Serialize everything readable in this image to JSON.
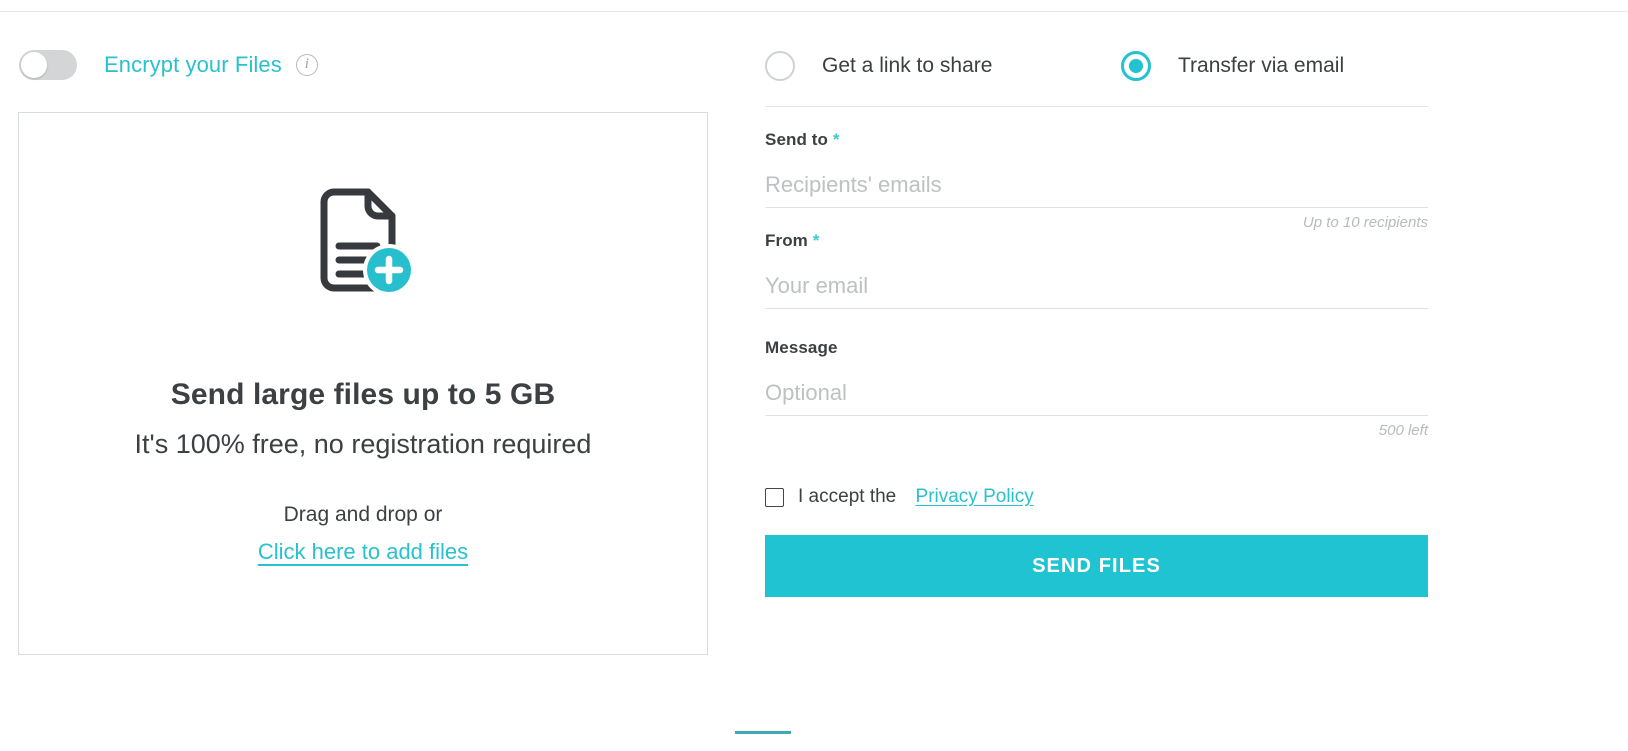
{
  "left": {
    "encrypt": {
      "label": "Encrypt your Files",
      "toggle_state": "off",
      "info_glyph": "i"
    },
    "dropzone": {
      "icon": "document-add-icon",
      "title": "Send large files up to 5 GB",
      "subtitle": "It's 100% free, no registration required",
      "drag_text": "Drag and drop or",
      "link_text": "Click here to add files"
    }
  },
  "right": {
    "options": [
      {
        "label": "Get a link to share",
        "selected": false
      },
      {
        "label": "Transfer via email",
        "selected": true
      }
    ],
    "send_to": {
      "label": "Send to",
      "required_mark": "*",
      "placeholder": "Recipients' emails",
      "value": "",
      "hint": "Up to 10 recipients"
    },
    "from": {
      "label": "From",
      "required_mark": "*",
      "placeholder": "Your email",
      "value": ""
    },
    "message": {
      "label": "Message",
      "placeholder": "Optional",
      "value": "",
      "hint": "500 left"
    },
    "accept": {
      "text": "I accept the",
      "link_text": "Privacy Policy",
      "checked": false
    },
    "submit_label": "SEND FILES"
  },
  "colors": {
    "accent": "#1fc3d2",
    "accent_text": "#29c1cd",
    "text": "#3c4043",
    "muted": "#bdc1c2",
    "hairline": "#e2e5e6",
    "icon_dark": "#36393d",
    "toggle_track": "#d3d5d6"
  }
}
